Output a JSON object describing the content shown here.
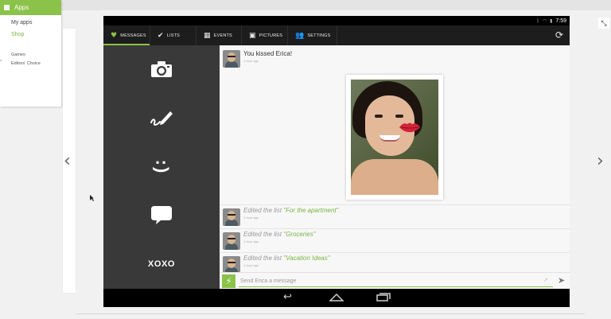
{
  "store": {
    "apps_label": "Apps",
    "my_apps": "My apps",
    "shop": "Shop",
    "games": "Games",
    "editors_choice": "Editors' Choice"
  },
  "status_bar": {
    "time": "7:59"
  },
  "nav": {
    "tabs": [
      {
        "label": "MESSAGES",
        "icon": "heart-icon"
      },
      {
        "label": "LISTS",
        "icon": "checkmark-icon"
      },
      {
        "label": "EVENTS",
        "icon": "calendar-icon"
      },
      {
        "label": "PICTURES",
        "icon": "picture-icon"
      },
      {
        "label": "SETTINGS",
        "icon": "people-icon"
      }
    ]
  },
  "tools": {
    "emoticon": ":)",
    "xoxo": "XOXO"
  },
  "feed": {
    "kiss_message": {
      "title": "You kissed Erica!",
      "time": "1 hour ago"
    },
    "edits": [
      {
        "prefix": "Edited the list ",
        "list_name": "\"For the apartment\"",
        "time": "1 hour ago"
      },
      {
        "prefix": "Edited the list ",
        "list_name": "\"Groceries\"",
        "time": "1 hour ago"
      },
      {
        "prefix": "Edited the list ",
        "list_name": "\"Vacation Ideas\"",
        "time": "1 hour ago"
      }
    ]
  },
  "compose": {
    "placeholder": "Send Erica a message"
  },
  "colors": {
    "accent": "#8bc34a",
    "sidebar": "#393939",
    "nav": "#1d1d1d"
  }
}
